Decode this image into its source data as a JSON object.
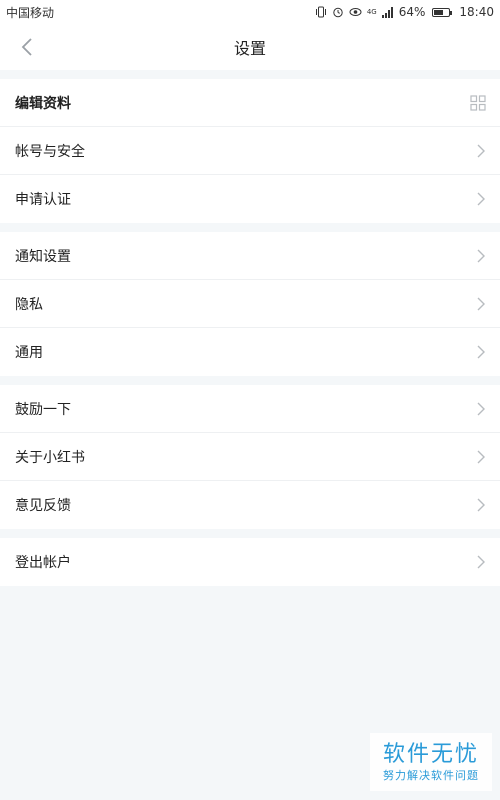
{
  "status_bar": {
    "carrier": "中国移动",
    "network": "4G",
    "battery_percent": "64%",
    "battery_level": 0.64,
    "time": "18:40",
    "icons": [
      "vibrate-icon",
      "alarm-icon",
      "eye-icon",
      "signal-icon",
      "battery-icon"
    ]
  },
  "nav": {
    "title": "设置",
    "back_icon": "chevron-left-icon"
  },
  "groups": [
    {
      "items": [
        {
          "label": "编辑资料",
          "icon": "qr-code-icon"
        },
        {
          "label": "帐号与安全",
          "icon": "chevron-right-icon"
        },
        {
          "label": "申请认证",
          "icon": "chevron-right-icon"
        }
      ]
    },
    {
      "items": [
        {
          "label": "通知设置",
          "icon": "chevron-right-icon"
        },
        {
          "label": "隐私",
          "icon": "chevron-right-icon"
        },
        {
          "label": "通用",
          "icon": "chevron-right-icon"
        }
      ]
    },
    {
      "items": [
        {
          "label": "鼓励一下",
          "icon": "chevron-right-icon"
        },
        {
          "label": "关于小红书",
          "icon": "chevron-right-icon"
        },
        {
          "label": "意见反馈",
          "icon": "chevron-right-icon"
        }
      ]
    },
    {
      "items": [
        {
          "label": "登出帐户",
          "icon": "chevron-right-icon"
        }
      ]
    }
  ],
  "watermark": {
    "title": "软件无忧",
    "subtitle": "努力解决软件问题"
  },
  "colors": {
    "background": "#f4f7f9",
    "surface": "#ffffff",
    "text": "#222222",
    "chevron": "#b8bcc0",
    "watermark": "#2a9bd8"
  }
}
